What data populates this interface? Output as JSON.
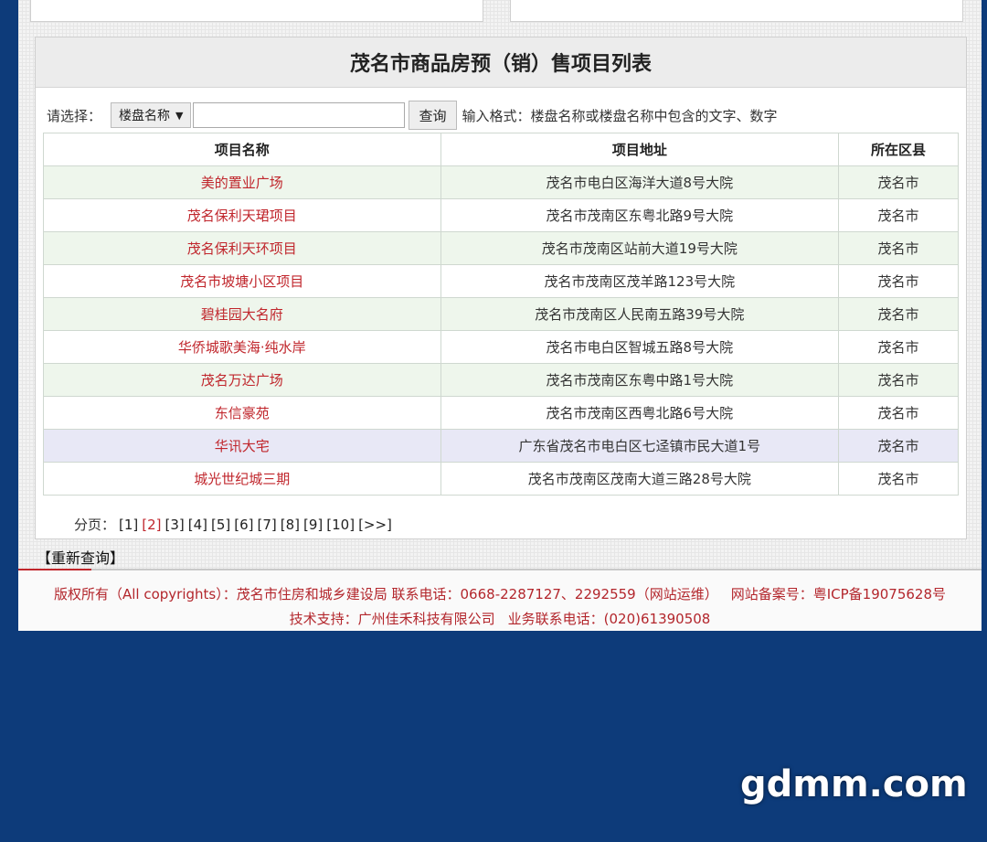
{
  "panel": {
    "title": "茂名市商品房预（销）售项目列表"
  },
  "search": {
    "label": "请选择：",
    "select_value": "楼盘名称",
    "input_value": "",
    "button_label": "查询",
    "format_hint": "输入格式：楼盘名称或楼盘名称中包含的文字、数字"
  },
  "table": {
    "headers": [
      "项目名称",
      "项目地址",
      "所在区县"
    ],
    "rows": [
      {
        "name": "美的置业广场",
        "address": "茂名市电白区海洋大道8号大院",
        "district": "茂名市"
      },
      {
        "name": "茂名保利天珺项目",
        "address": "茂名市茂南区东粤北路9号大院",
        "district": "茂名市"
      },
      {
        "name": "茂名保利天环项目",
        "address": "茂名市茂南区站前大道19号大院",
        "district": "茂名市"
      },
      {
        "name": "茂名市坡塘小区项目",
        "address": "茂名市茂南区茂羊路123号大院",
        "district": "茂名市"
      },
      {
        "name": "碧桂园大名府",
        "address": "茂名市茂南区人民南五路39号大院",
        "district": "茂名市"
      },
      {
        "name": "华侨城歌美海·纯水岸",
        "address": "茂名市电白区智城五路8号大院",
        "district": "茂名市"
      },
      {
        "name": "茂名万达广场",
        "address": "茂名市茂南区东粤中路1号大院",
        "district": "茂名市"
      },
      {
        "name": "东信豪苑",
        "address": "茂名市茂南区西粤北路6号大院",
        "district": "茂名市"
      },
      {
        "name": "华讯大宅",
        "address": "广东省茂名市电白区七迳镇市民大道1号",
        "district": "茂名市"
      },
      {
        "name": "城光世纪城三期",
        "address": "茂名市茂南区茂南大道三路28号大院",
        "district": "茂名市"
      }
    ]
  },
  "pager": {
    "label": "分页：",
    "pages": [
      "[1]",
      "[2]",
      "[3]",
      "[4]",
      "[5]",
      "[6]",
      "[7]",
      "[8]",
      "[9]",
      "[10]",
      "[>>]"
    ],
    "current": "[2]"
  },
  "requery_label": "【重新查询】",
  "footer": {
    "copyright": "版权所有（All copyrights）：茂名市住房和城乡建设局",
    "phone": "联系电话：0668-2287127、2292559（网站运维）",
    "icp": "网站备案号：粤ICP备19075628号",
    "tech_support": "技术支持：广州佳禾科技有限公司",
    "business_phone": "业务联系电话：(020)61390508"
  },
  "watermark": "gdmm.com",
  "colors": {
    "background": "#0d3b7a",
    "link_red": "#c0262c",
    "row_green": "#eef6ec",
    "row_purple": "#e8e8f6"
  }
}
